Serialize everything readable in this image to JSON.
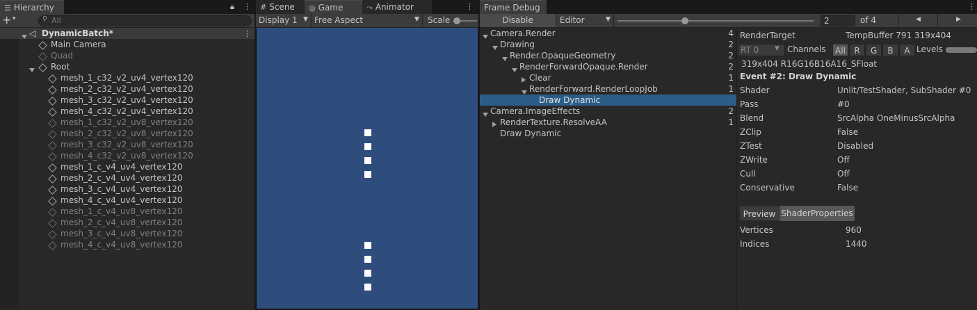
{
  "hierarchy": {
    "tab_label": "Hierarchy",
    "search_placeholder": "All",
    "scene_name": "DynamicBatch*",
    "items": [
      {
        "label": "Main Camera",
        "dim": false
      },
      {
        "label": "Quad",
        "dim": true
      },
      {
        "label": "Root",
        "dim": false
      }
    ],
    "children": [
      {
        "label": "mesh_1_c32_v2_uv4_vertex120",
        "dim": false
      },
      {
        "label": "mesh_2_c32_v2_uv4_vertex120",
        "dim": false
      },
      {
        "label": "mesh_3_c32_v2_uv4_vertex120",
        "dim": false
      },
      {
        "label": "mesh_4_c32_v2_uv4_vertex120",
        "dim": false
      },
      {
        "label": "mesh_1_c32_v2_uv8_vertex120",
        "dim": true
      },
      {
        "label": "mesh_2_c32_v2_uv8_vertex120",
        "dim": true
      },
      {
        "label": "mesh_3_c32_v2_uv8_vertex120",
        "dim": true
      },
      {
        "label": "mesh_4_c32_v2_uv8_vertex120",
        "dim": true
      },
      {
        "label": "mesh_1_c_v4_uv4_vertex120",
        "dim": false
      },
      {
        "label": "mesh_2_c_v4_uv4_vertex120",
        "dim": false
      },
      {
        "label": "mesh_3_c_v4_uv4_vertex120",
        "dim": false
      },
      {
        "label": "mesh_4_c_v4_uv4_vertex120",
        "dim": false
      },
      {
        "label": "mesh_1_c_v4_uv8_vertex120",
        "dim": true
      },
      {
        "label": "mesh_2_c_v4_uv8_vertex120",
        "dim": true
      },
      {
        "label": "mesh_3_c_v4_uv8_vertex120",
        "dim": true
      },
      {
        "label": "mesh_4_c_v4_uv8_vertex120",
        "dim": true
      }
    ]
  },
  "game": {
    "tabs": {
      "scene": "Scene",
      "game": "Game",
      "animator": "Animator"
    },
    "display": "Display 1",
    "aspect": "Free Aspect",
    "scale_label": "Scale",
    "viewport_color": "#2e4d7c"
  },
  "frame_debug": {
    "tab_label": "Frame Debug",
    "disable_label": "Disable",
    "editor_label": "Editor",
    "event_index": "2",
    "event_total": "of 4",
    "tree": [
      {
        "label": "Camera.Render",
        "count": "4",
        "indent": 0,
        "arrow": "down"
      },
      {
        "label": "Drawing",
        "count": "2",
        "indent": 1,
        "arrow": "down"
      },
      {
        "label": "Render.OpaqueGeometry",
        "count": "2",
        "indent": 2,
        "arrow": "down"
      },
      {
        "label": "RenderForwardOpaque.Render",
        "count": "2",
        "indent": 3,
        "arrow": "down"
      },
      {
        "label": "Clear",
        "count": "1",
        "indent": 4,
        "arrow": "right"
      },
      {
        "label": "RenderForward.RenderLoopJob",
        "count": "1",
        "indent": 4,
        "arrow": "down"
      },
      {
        "label": "Draw Dynamic",
        "count": "",
        "indent": 5,
        "arrow": "none",
        "selected": true
      },
      {
        "label": "Camera.ImageEffects",
        "count": "2",
        "indent": 0,
        "arrow": "down"
      },
      {
        "label": "RenderTexture.ResolveAA",
        "count": "1",
        "indent": 1,
        "arrow": "right"
      },
      {
        "label": "Draw Dynamic",
        "count": "",
        "indent": 1,
        "arrow": "none"
      }
    ],
    "render_target_label": "RenderTarget",
    "render_target_value": "TempBuffer 791 319x404",
    "rt_label": "RT 0",
    "channels_label": "Channels",
    "channels": [
      "All",
      "R",
      "G",
      "B",
      "A"
    ],
    "levels_label": "Levels",
    "format_text": "319x404 R16G16B16A16_SFloat",
    "event_title": "Event #2: Draw Dynamic",
    "properties": [
      {
        "key": "Shader",
        "value": "Unlit/TestShader, SubShader #0"
      },
      {
        "key": "Pass",
        "value": "#0"
      },
      {
        "key": "Blend",
        "value": "SrcAlpha OneMinusSrcAlpha"
      },
      {
        "key": "ZClip",
        "value": "False"
      },
      {
        "key": "ZTest",
        "value": "Disabled"
      },
      {
        "key": "ZWrite",
        "value": "Off"
      },
      {
        "key": "Cull",
        "value": "Off"
      },
      {
        "key": "Conservative",
        "value": "False"
      }
    ],
    "preview_tab": "Preview",
    "shader_props_tab": "ShaderProperties",
    "stats": [
      {
        "key": "Vertices",
        "value": "960"
      },
      {
        "key": "Indices",
        "value": "1440"
      }
    ]
  }
}
